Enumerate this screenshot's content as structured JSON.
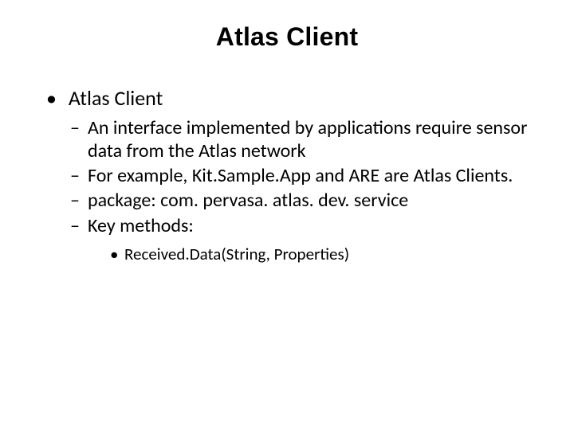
{
  "title": "Atlas Client",
  "bullets": {
    "l1": "Atlas Client",
    "l2": {
      "a": "An interface implemented by applications require sensor data from the Atlas network",
      "b": "For example, Kit.Sample.App and ARE are Atlas Clients.",
      "c": "package: com. pervasa. atlas. dev. service",
      "d": "Key methods:"
    },
    "l3": {
      "a": "Received.Data(String, Properties)"
    }
  }
}
